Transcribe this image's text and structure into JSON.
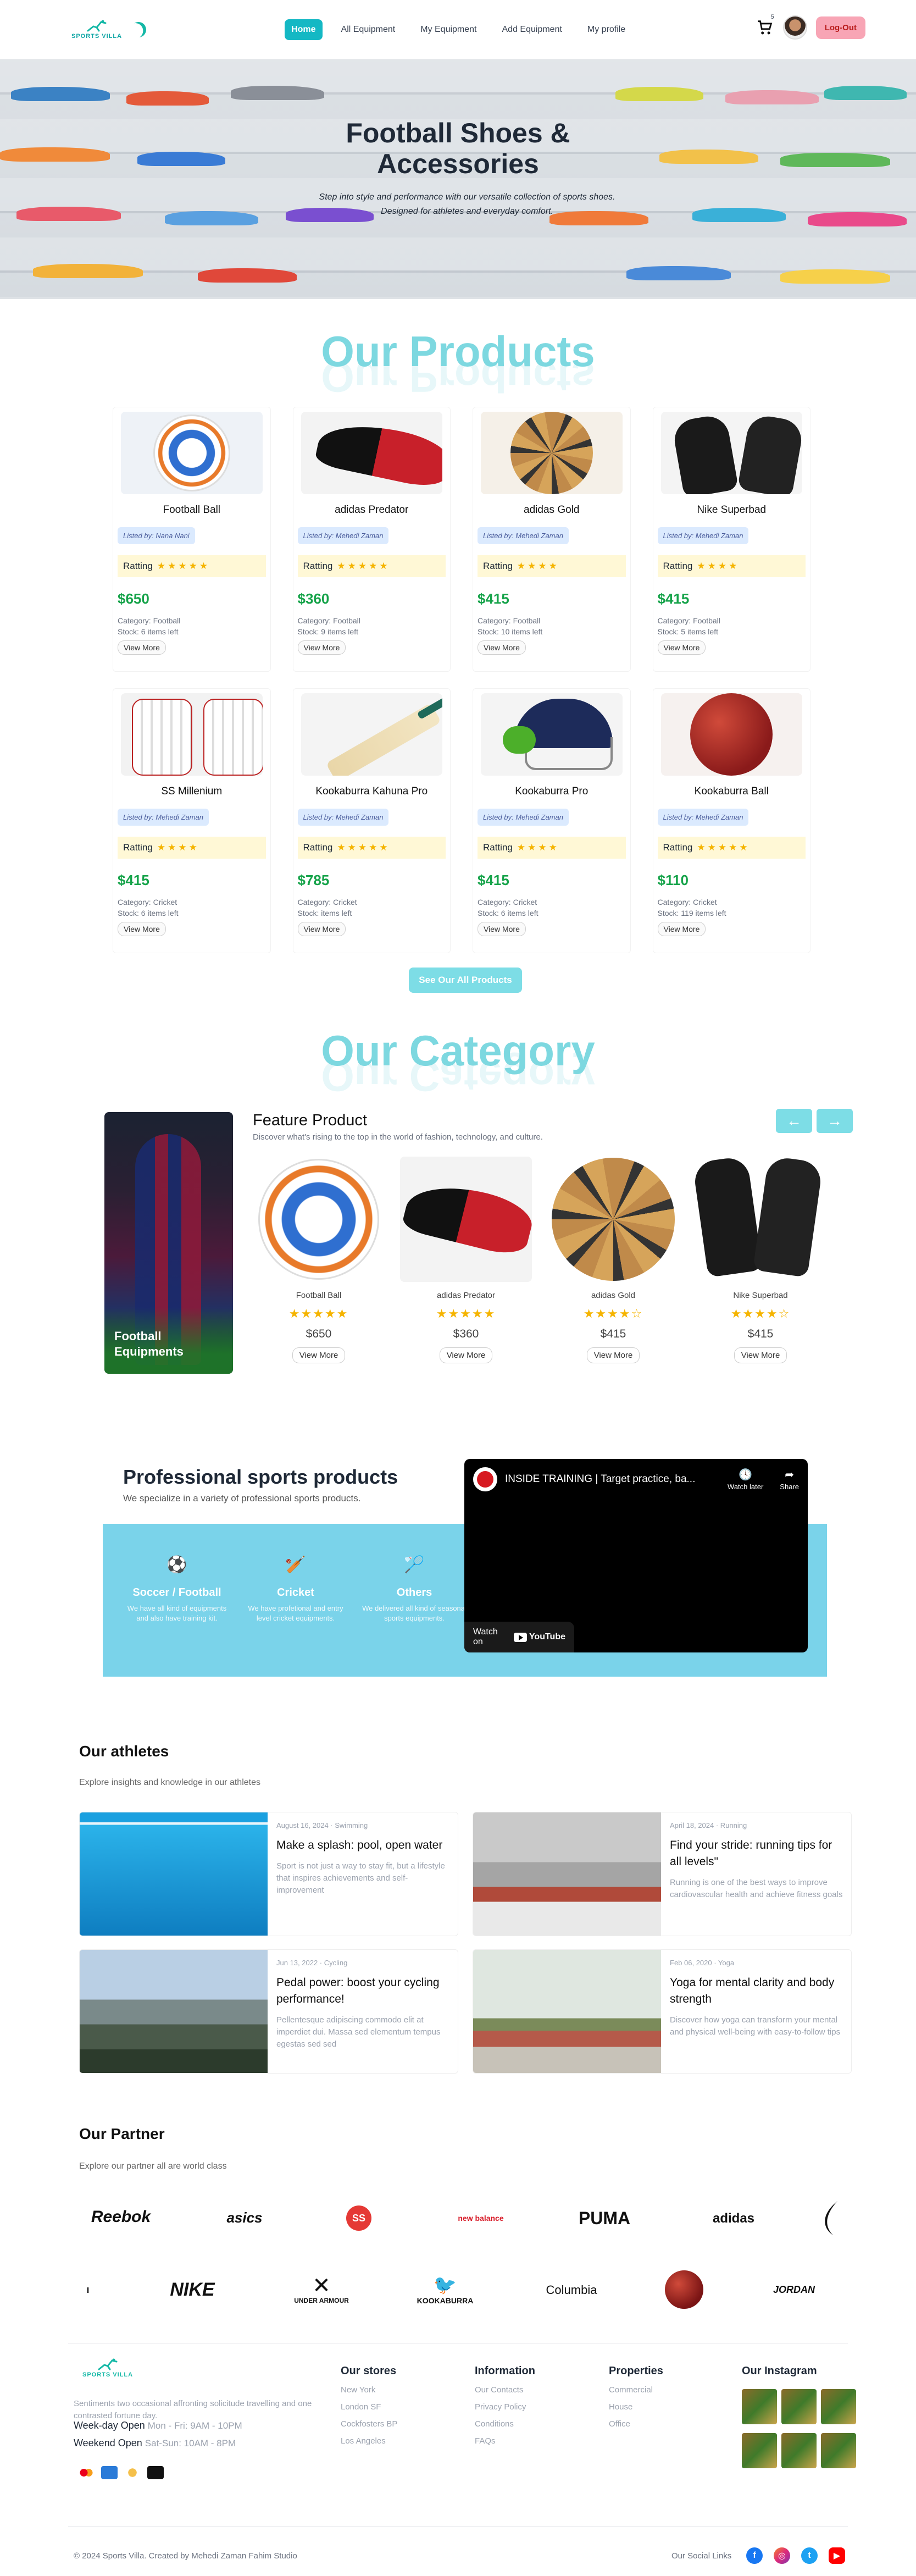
{
  "nav": {
    "logo_text": "SPORTS VILLA",
    "links": [
      "Home",
      "All Equipment",
      "My Equipment",
      "Add Equipment",
      "My profile"
    ],
    "cart_count": "5",
    "logout": "Log-Out"
  },
  "hero": {
    "title_line1": "Football Shoes &",
    "title_line2": "Accessories",
    "subtitle": "Step into style and performance with our versatile collection of sports shoes. Designed for athletes and everyday comfort."
  },
  "products_title": "Our Products",
  "products": [
    {
      "name": "Football Ball",
      "listed": "Listed by: Nana Nani",
      "rating_label": "Ratting",
      "stars": 5,
      "price": "$650",
      "category": "Category: Football",
      "stock": "Stock: 6 items left",
      "view": "View More"
    },
    {
      "name": "adidas Predator",
      "listed": "Listed by: Mehedi Zaman",
      "rating_label": "Ratting",
      "stars": 5,
      "price": "$360",
      "category": "Category: Football",
      "stock": "Stock: 9 items left",
      "view": "View More"
    },
    {
      "name": "adidas Gold",
      "listed": "Listed by: Mehedi Zaman",
      "rating_label": "Ratting",
      "stars": 4,
      "price": "$415",
      "category": "Category: Football",
      "stock": "Stock: 10 items left",
      "view": "View More"
    },
    {
      "name": "Nike Superbad",
      "listed": "Listed by: Mehedi Zaman",
      "rating_label": "Ratting",
      "stars": 4,
      "price": "$415",
      "category": "Category: Football",
      "stock": "Stock: 5 items left",
      "view": "View More"
    },
    {
      "name": "SS Millenium",
      "listed": "Listed by: Mehedi Zaman",
      "rating_label": "Ratting",
      "stars": 4,
      "price": "$415",
      "category": "Category: Cricket",
      "stock": "Stock: 6 items left",
      "view": "View More"
    },
    {
      "name": "Kookaburra Kahuna Pro",
      "listed": "Listed by: Mehedi Zaman",
      "rating_label": "Ratting",
      "stars": 5,
      "price": "$785",
      "category": "Category: Cricket",
      "stock": "Stock: items left",
      "view": "View More"
    },
    {
      "name": "Kookaburra Pro",
      "listed": "Listed by: Mehedi Zaman",
      "rating_label": "Ratting",
      "stars": 4,
      "price": "$415",
      "category": "Category: Cricket",
      "stock": "Stock: 6 items left",
      "view": "View More"
    },
    {
      "name": "Kookaburra Ball",
      "listed": "Listed by: Mehedi Zaman",
      "rating_label": "Ratting",
      "stars": 5,
      "price": "$110",
      "category": "Category: Cricket",
      "stock": "Stock: 119 items left",
      "view": "View More"
    }
  ],
  "see_all": "See Our All Products",
  "category_title": "Our Category",
  "category": {
    "tile_label_1": "Football",
    "tile_label_2": "Equipments",
    "feature_title": "Feature Product",
    "feature_sub": "Discover what's rising to the top in the world of fashion, technology, and culture.",
    "prev": "←",
    "next": "→",
    "items": [
      {
        "name": "Football Ball",
        "stars": "★★★★★",
        "price": "$650",
        "view": "View More"
      },
      {
        "name": "adidas Predator",
        "stars": "★★★★★",
        "price": "$360",
        "view": "View More"
      },
      {
        "name": "adidas Gold",
        "stars": "★★★★☆",
        "price": "$415",
        "view": "View More"
      },
      {
        "name": "Nike Superbad",
        "stars": "★★★★☆",
        "price": "$415",
        "view": "View More"
      }
    ]
  },
  "professional": {
    "title": "Professional sports products",
    "sub": "We specialize in a variety of professional sports products.",
    "items": [
      {
        "title": "Soccer / Football",
        "desc": "We have all kind of equipments and also have training kit."
      },
      {
        "title": "Cricket",
        "desc": "We have profetional and entry level cricket equipments."
      },
      {
        "title": "Others",
        "desc": "We delivered all kind of seasonal sports equipments."
      }
    ],
    "video": {
      "title": "INSIDE TRAINING | Target practice, ba...",
      "watch_later": "Watch later",
      "share": "Share",
      "watch_on": "Watch on",
      "youtube": "YouTube"
    }
  },
  "athletes": {
    "title": "Our athletes",
    "sub": "Explore insights and knowledge in our athletes",
    "posts": [
      {
        "date": "August 16, 2024 · Swimming",
        "title": "Make a splash: pool, open water",
        "excerpt": "Sport is not just a way to stay fit, but a lifestyle that inspires achievements and self-improvement"
      },
      {
        "date": "April 18, 2024 · Running",
        "title": "Find your stride: running tips for all levels\"",
        "excerpt": "Running is one of the best ways to improve cardiovascular health and achieve fitness goals"
      },
      {
        "date": "Jun 13, 2022 · Cycling",
        "title": "Pedal power: boost your cycling performance!",
        "excerpt": "Pellentesque adipiscing commodo elit at imperdiet dui. Massa sed elementum tempus egestas sed sed"
      },
      {
        "date": "Feb 06, 2020 · Yoga",
        "title": "Yoga for mental clarity and body strength",
        "excerpt": "Discover how yoga can transform your mental and physical well-being with easy-to-follow tips"
      }
    ]
  },
  "partner": {
    "title": "Our Partner",
    "sub": "Explore our partner all are world class",
    "row1": [
      "Reebok",
      "asics",
      "SS",
      "new balance",
      "PUMA",
      "adidas"
    ],
    "row2": [
      "NIKE",
      "UNDER ARMOUR",
      "KOOKABURRA",
      "Columbia",
      "JORDAN"
    ]
  },
  "footer": {
    "logo_text": "SPORTS VILLA",
    "about": "Sentiments two occasional affronting solicitude travelling and one contrasted fortune day.",
    "weekday_label": "Week-day Open",
    "weekday_hours": "Mon - Fri: 9AM - 10PM",
    "weekend_label": "Weekend Open",
    "weekend_hours": "Sat-Sun: 10AM - 8PM",
    "stores_title": "Our stores",
    "stores": [
      "New York",
      "London SF",
      "Cockfosters BP",
      "Los Angeles"
    ],
    "info_title": "Information",
    "info": [
      "Our Contacts",
      "Privacy Policy",
      "Conditions",
      "FAQs"
    ],
    "props_title": "Properties",
    "props": [
      "Commercial",
      "House",
      "Office"
    ],
    "insta_title": "Our Instagram",
    "copyright": "© 2024 Sports Villa. Created by Mehedi Zaman Fahim Studio",
    "social_label": "Our Social Links"
  },
  "colors": {
    "accent": "#14b8c4",
    "section_title": "#7dd8e0",
    "price": "#16a34a",
    "logout_bg": "#f8a5b5",
    "pro_box": "#7ad3ea"
  }
}
